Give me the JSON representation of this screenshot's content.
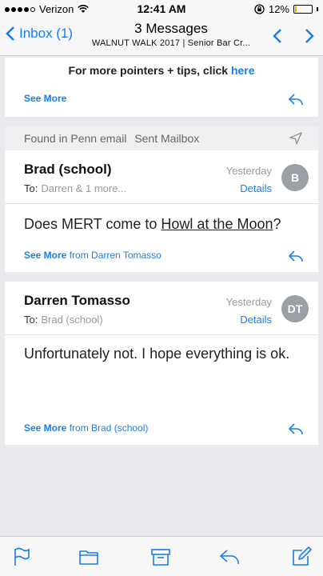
{
  "status_bar": {
    "carrier": "Verizon",
    "time": "12:41 AM",
    "battery": "12%",
    "battery_level": 0.12,
    "icons": [
      "signal-dots",
      "wifi-icon",
      "rotation-lock-icon",
      "battery-icon"
    ]
  },
  "nav": {
    "back_label": "Inbox (1)",
    "title": "3 Messages",
    "subtitle": "WALNUT WALK 2017 | Senior Bar Cr...",
    "icons": [
      "chevron-left-icon",
      "chevron-up-icon",
      "chevron-down-icon"
    ]
  },
  "top_card": {
    "pointers_text": "For more pointers + tips, click ",
    "pointers_link": "here",
    "see_more": "See More"
  },
  "found_header": {
    "label": "Found in Penn email",
    "mailbox": "Sent Mailbox"
  },
  "messages": [
    {
      "sender": "Brad (school)",
      "to_label": "To:",
      "to": "Darren & 1 more...",
      "date": "Yesterday",
      "details": "Details",
      "avatar": "B",
      "body_pre": "Does MERT come to ",
      "body_link": "Howl at the Moon",
      "body_post": "?",
      "see_more": "See More",
      "see_more_from": "from Darren Tomasso"
    },
    {
      "sender": "Darren Tomasso",
      "to_label": "To:",
      "to": "Brad (school)",
      "date": "Yesterday",
      "details": "Details",
      "avatar": "DT",
      "body": "Unfortunately not. I hope everything is ok.",
      "see_more": "See More",
      "see_more_from": "from Brad (school)"
    }
  ],
  "toolbar": {
    "icons": [
      "flag-icon",
      "folder-icon",
      "archive-icon",
      "reply-icon",
      "compose-icon"
    ]
  },
  "colors": {
    "accent": "#1a7cf2",
    "background": "#e9e9ee",
    "avatar": "#9c9fa6"
  }
}
